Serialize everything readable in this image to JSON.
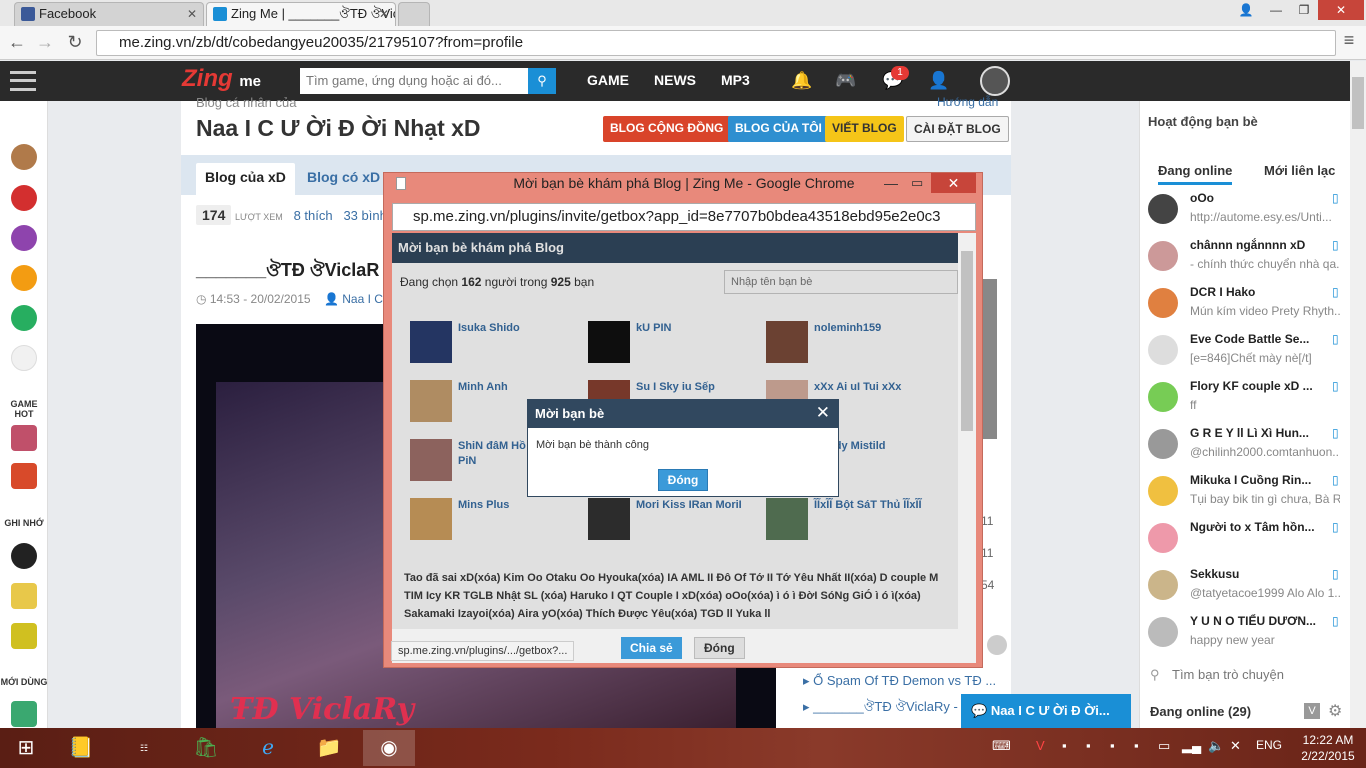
{
  "browser": {
    "tabs": [
      {
        "title": "Facebook",
        "color": "#3b5998"
      },
      {
        "title": "Zing Me | _______ঔTĐ ঔViclaRy",
        "color": "#1a8fd6"
      }
    ],
    "url": "me.zing.vn/zb/dt/cobedangyeu20035/21795107?from=profile"
  },
  "header": {
    "logo": "Zing",
    "logo_sub": "me",
    "search_placeholder": "Tìm game, ứng dụng hoặc ai đó...",
    "menu": [
      "GAME",
      "NEWS",
      "MP3"
    ],
    "notif_count": "1"
  },
  "left_sidebar": {
    "sections": [
      "GAME HOT",
      "GHI NHỚ",
      "MỚI DÙNG"
    ]
  },
  "blog": {
    "owner_label": "Blog cá nhân của",
    "owner_name": "Naa I C Ư Ời Đ Ời Nhạt xD",
    "help": "Hướng dẫn",
    "buttons": [
      "BLOG CỘNG ĐỒNG",
      "BLOG CỦA TÔI",
      "VIẾT BLOG",
      "CÀI ĐẶT BLOG"
    ],
    "tabs": [
      "Blog của xD",
      "Blog có xD"
    ],
    "views": "174",
    "views_label": "LƯỢT XEM",
    "likes": "8 thích",
    "comments": "33 bình",
    "post_title": "_______ঔTĐ ঔViclaR",
    "post_date": "14:53 - 20/02/2015",
    "post_author": "Naa I C",
    "image_text": "ŦĐ ViclaRy",
    "side_nums": [
      "11",
      "11",
      "54"
    ],
    "related": [
      "Ổ Spam Of TĐ Demon vs TĐ ...",
      "_______ঔTĐ ঔViclaRy -"
    ]
  },
  "right_panel": {
    "title": "Hoạt động bạn bè",
    "tabs": [
      "Đang online",
      "Mới liên lạc"
    ],
    "friends": [
      {
        "name": "oOo",
        "status": "http://autome.esy.es/Unti..."
      },
      {
        "name": "chânnn ngắnnnn xD",
        "status": "- chính thức chuyển nhà qa..."
      },
      {
        "name": "DCR I Hako",
        "status": "Mún kím video Prety Rhyth..."
      },
      {
        "name": "Eve Code Battle Se...",
        "status": "[e=846]Chết mày nè[/t]"
      },
      {
        "name": "Flory KF couple xD ...",
        "status": "ff"
      },
      {
        "name": "G R E Y ll Lì Xì Hun...",
        "status": "@chilinh2000.comtanhuon..."
      },
      {
        "name": "Mikuka I Cuồng Rin...",
        "status": "Tụi bay bik tin gì chưa, Bà R..."
      },
      {
        "name": "Người to x Tâm hồn...",
        "status": ""
      },
      {
        "name": "Sekkusu",
        "status": "@tatyetacoe1999 Alo Alo 1..."
      },
      {
        "name": "Y U N O TIỂU DƯƠN...",
        "status": "happy new year"
      }
    ],
    "search_placeholder": "Tìm bạn trò chuyện",
    "online_count": "Đang online (29)",
    "chat_popup": "Naa I C Ư Ời Đ Ời..."
  },
  "popup": {
    "window_title": "Mời bạn bè khám phá Blog | Zing Me - Google Chrome",
    "url": "sp.me.zing.vn/plugins/invite/getbox?app_id=8e7707b0bdea43518ebd95e2e0c3",
    "header": "Mời bạn bè khám phá Blog",
    "count_pre": "Đang chọn",
    "count_sel": "162",
    "count_mid": "người trong",
    "count_total": "925",
    "count_post": "bạn",
    "find_placeholder": "Nhập tên bạn bè",
    "friends": [
      "Isuka Shido",
      "kU PIN",
      "noleminh159",
      "Minh Anh",
      "Su I Sky iu Sếp",
      "xXx Ai uI Tui xXx",
      "ShiN đâM Hồ TớT CúG PiN",
      "",
      "Candy Mistild",
      "Mins Plus",
      "Mori Kiss IRan MoriI",
      "ĨĨxĨĨ Bột SáT Thủ ĨĨxĨĨ"
    ],
    "tagged": "Tao đã sai xD(xóa) Kim Oo Otaku Oo Hyouka(xóa) IA AML II Đô Of Tớ II Tớ Yêu Nhất II(xóa) D couple M TIM Icy KR TGLB Nhật SL (xóa) Haruko I QT Couple I xD(xóa) oOo(xóa) ì ó ì ĐờI SóNg GiÓ ì ó ì(xóa) Sakamaki Izayoi(xóa) Aira yO(xóa) Thích Được Yêu(xóa) TGD ll Yuka ll",
    "share": "Chia sẻ",
    "close": "Đóng",
    "status_url": "sp.me.zing.vn/plugins/.../getbox?..."
  },
  "modal": {
    "title": "Mời bạn bè",
    "message": "Mời bạn bè thành công",
    "ok": "Đóng"
  },
  "taskbar": {
    "lang": "ENG",
    "time": "12:22 AM",
    "date": "2/22/2015"
  }
}
